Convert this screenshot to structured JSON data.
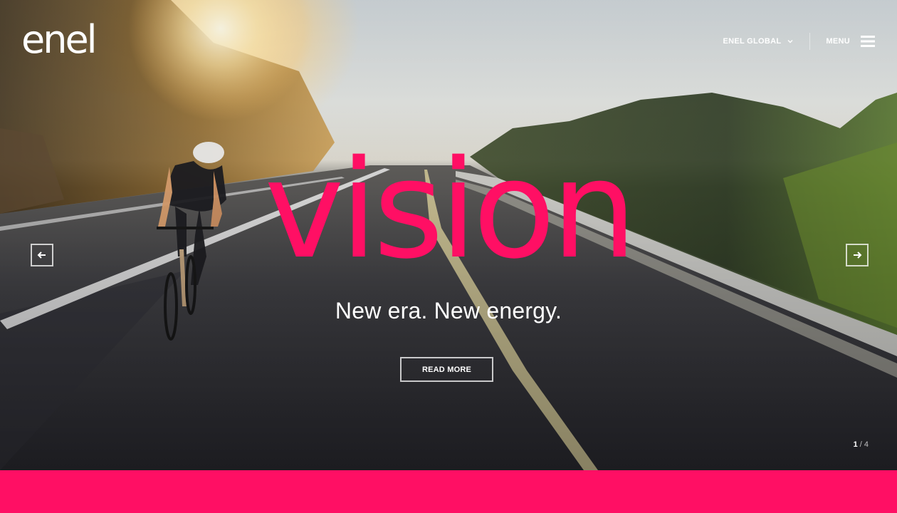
{
  "brand": {
    "logo_text": "enel",
    "accent_color": "#ff0f64"
  },
  "header": {
    "region_label": "ENEL GLOBAL",
    "menu_label": "MENU"
  },
  "hero": {
    "headline": "vision",
    "tagline": "New era. New energy.",
    "cta_label": "READ MORE",
    "slide_current": "1",
    "slide_separator": " / ",
    "slide_total": "4"
  },
  "icons": {
    "region_chevron": "chevron-down-icon",
    "menu": "hamburger-menu-icon",
    "prev": "arrow-left-icon",
    "next": "arrow-right-icon"
  }
}
